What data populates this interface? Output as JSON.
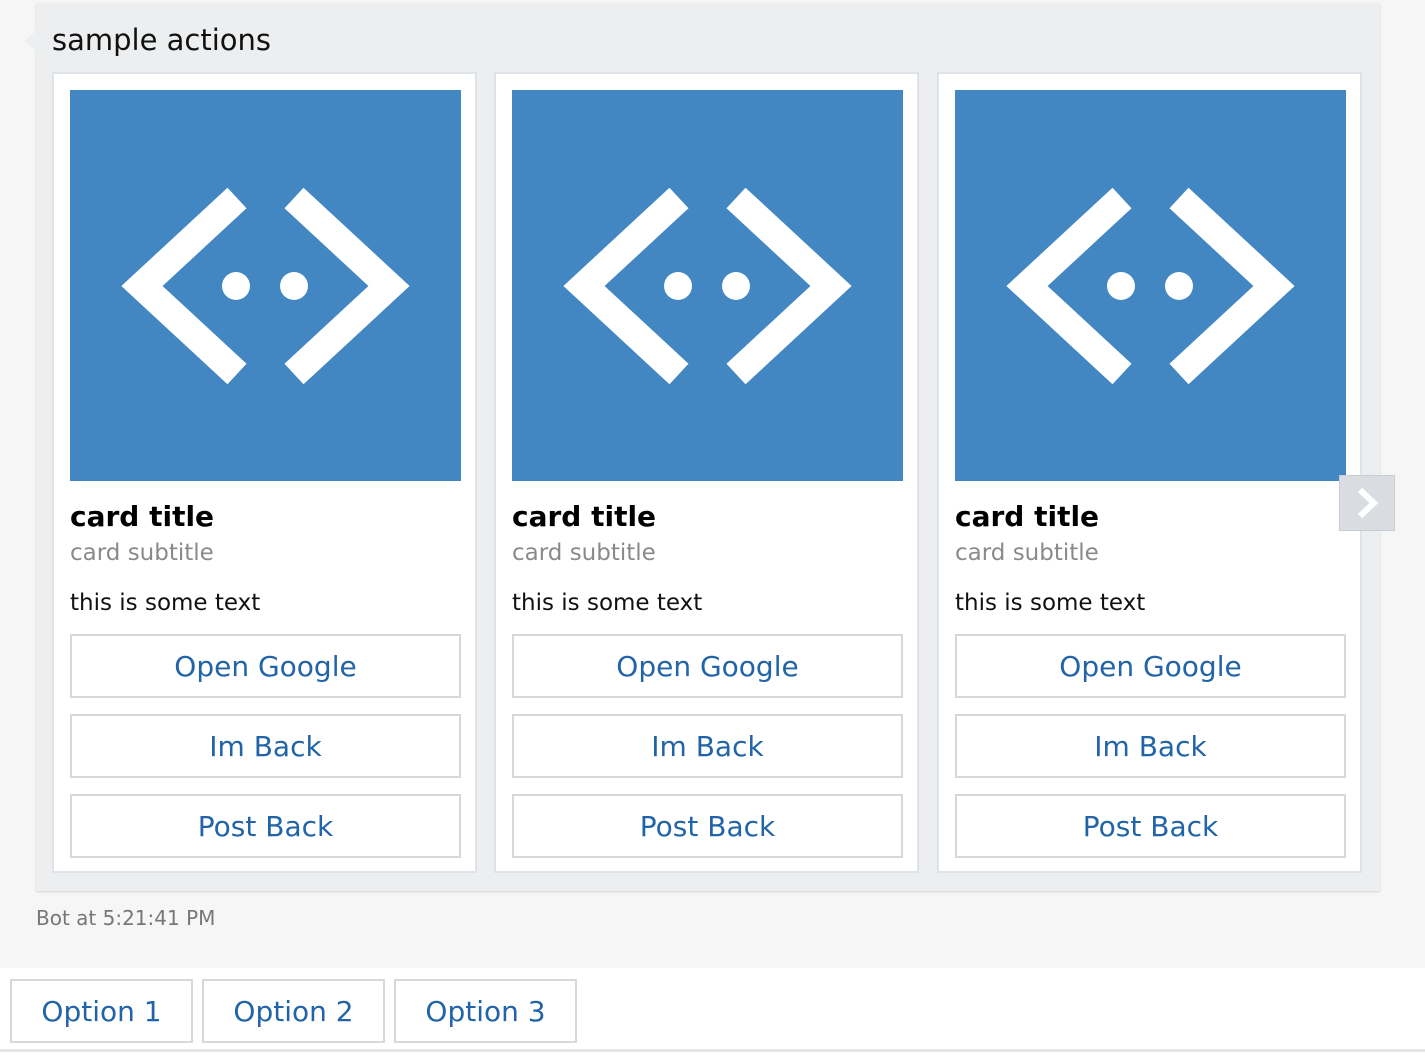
{
  "message": {
    "text": "sample actions",
    "timestamp": "Bot at 5:21:41 PM"
  },
  "cards": [
    {
      "image_icon": "bot-framework-icon",
      "title": "card title",
      "subtitle": "card subtitle",
      "text": "this is some text",
      "buttons": [
        "Open Google",
        "Im Back",
        "Post Back"
      ]
    },
    {
      "image_icon": "bot-framework-icon",
      "title": "card title",
      "subtitle": "card subtitle",
      "text": "this is some text",
      "buttons": [
        "Open Google",
        "Im Back",
        "Post Back"
      ]
    },
    {
      "image_icon": "bot-framework-icon",
      "title": "card title",
      "subtitle": "card subtitle",
      "text": "this is some text",
      "buttons": [
        "Open Google",
        "Im Back",
        "Post Back"
      ]
    }
  ],
  "carousel": {
    "next_icon": "chevron-right-icon"
  },
  "suggested_actions": [
    "Option 1",
    "Option 2",
    "Option 3"
  ],
  "colors": {
    "card_image_bg": "#4286c2",
    "button_text": "#2264a8",
    "bubble_bg": "#eceef0"
  }
}
